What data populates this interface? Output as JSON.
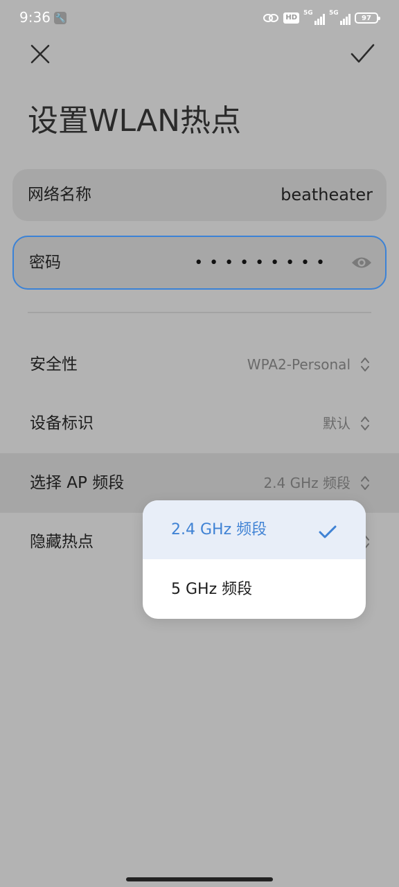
{
  "status_bar": {
    "time": "9:36",
    "hd_label": "HD",
    "signal1_label": "5G",
    "signal2_label": "5G",
    "battery_level": "97"
  },
  "header": {
    "title": "设置WLAN热点"
  },
  "fields": {
    "network_name_label": "网络名称",
    "network_name_value": "beatheater",
    "password_label": "密码",
    "password_masked": "•••••••••"
  },
  "rows": {
    "security": {
      "label": "安全性",
      "value": "WPA2-Personal"
    },
    "device_id": {
      "label": "设备标识",
      "value": "默认"
    },
    "ap_band": {
      "label": "选择 AP 频段",
      "value": "2.4 GHz 频段"
    },
    "hidden_hotspot": {
      "label": "隐藏热点"
    }
  },
  "popup": {
    "options": [
      {
        "label": "2.4 GHz 频段",
        "selected": true
      },
      {
        "label": "5 GHz 频段",
        "selected": false
      }
    ]
  },
  "colors": {
    "accent": "#3f82d4",
    "focus_border": "#3b82d6",
    "background": "#b3b3b3"
  }
}
